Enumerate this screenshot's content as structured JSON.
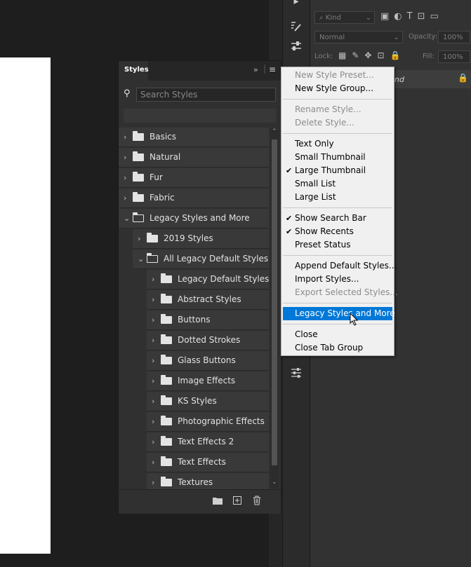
{
  "styles_panel": {
    "tab_label": "Styles",
    "search_placeholder": "Search Styles",
    "items": [
      {
        "label": "Basics",
        "expanded": false,
        "level": 0
      },
      {
        "label": "Natural",
        "expanded": false,
        "level": 0
      },
      {
        "label": "Fur",
        "expanded": false,
        "level": 0
      },
      {
        "label": "Fabric",
        "expanded": false,
        "level": 0
      },
      {
        "label": "Legacy Styles and More",
        "expanded": true,
        "level": 0
      },
      {
        "label": "2019 Styles",
        "expanded": false,
        "level": 1
      },
      {
        "label": "All Legacy Default Styles",
        "expanded": true,
        "level": 1
      },
      {
        "label": "Legacy Default Styles",
        "expanded": false,
        "level": 2
      },
      {
        "label": "Abstract Styles",
        "expanded": false,
        "level": 2
      },
      {
        "label": "Buttons",
        "expanded": false,
        "level": 2
      },
      {
        "label": "Dotted Strokes",
        "expanded": false,
        "level": 2
      },
      {
        "label": "Glass Buttons",
        "expanded": false,
        "level": 2
      },
      {
        "label": "Image Effects",
        "expanded": false,
        "level": 2
      },
      {
        "label": "KS Styles",
        "expanded": false,
        "level": 2
      },
      {
        "label": "Photographic Effects",
        "expanded": false,
        "level": 2
      },
      {
        "label": "Text Effects 2",
        "expanded": false,
        "level": 2
      },
      {
        "label": "Text Effects",
        "expanded": false,
        "level": 2
      },
      {
        "label": "Textures",
        "expanded": false,
        "level": 2
      }
    ]
  },
  "menu": {
    "groups": [
      [
        {
          "label": "New Style Preset...",
          "disabled": true,
          "checked": false
        },
        {
          "label": "New Style Group...",
          "disabled": false,
          "checked": false
        }
      ],
      [
        {
          "label": "Rename Style...",
          "disabled": true,
          "checked": false
        },
        {
          "label": "Delete Style...",
          "disabled": true,
          "checked": false
        }
      ],
      [
        {
          "label": "Text Only",
          "disabled": false,
          "checked": false
        },
        {
          "label": "Small Thumbnail",
          "disabled": false,
          "checked": false
        },
        {
          "label": "Large Thumbnail",
          "disabled": false,
          "checked": true
        },
        {
          "label": "Small List",
          "disabled": false,
          "checked": false
        },
        {
          "label": "Large List",
          "disabled": false,
          "checked": false
        }
      ],
      [
        {
          "label": "Show Search Bar",
          "disabled": false,
          "checked": true
        },
        {
          "label": "Show Recents",
          "disabled": false,
          "checked": true
        },
        {
          "label": "Preset Status",
          "disabled": false,
          "checked": false
        }
      ],
      [
        {
          "label": "Append Default Styles...",
          "disabled": false,
          "checked": false
        },
        {
          "label": "Import Styles...",
          "disabled": false,
          "checked": false
        },
        {
          "label": "Export Selected Styles...",
          "disabled": true,
          "checked": false
        }
      ],
      [
        {
          "label": "Legacy Styles and More",
          "disabled": false,
          "checked": false,
          "highlighted": true
        }
      ],
      [
        {
          "label": "Close",
          "disabled": false,
          "checked": false
        },
        {
          "label": "Close Tab Group",
          "disabled": false,
          "checked": false
        }
      ]
    ]
  },
  "layers_panel": {
    "kind_label": "Kind",
    "blend_mode": "Normal",
    "opacity_label": "Opacity:",
    "opacity_value": "100%",
    "lock_label": "Lock:",
    "fill_label": "Fill:",
    "fill_value": "100%",
    "layer_name_partial": "nd"
  },
  "colors": {
    "menu_highlight": "#0078d7",
    "panel_bg": "#303030",
    "row_bg": "#393939"
  }
}
